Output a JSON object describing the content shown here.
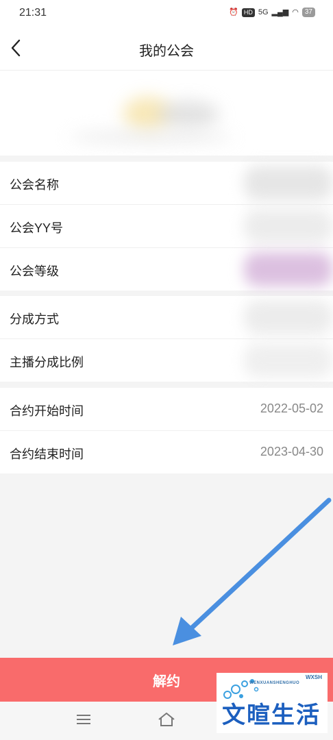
{
  "status_bar": {
    "time": "21:31",
    "hd_label": "HD",
    "network_label": "5G",
    "battery": "37"
  },
  "header": {
    "title": "我的公会",
    "back_icon": "chevron-left-icon"
  },
  "guild_info": {
    "rows": [
      {
        "label": "公会名称"
      },
      {
        "label": "公会YY号"
      },
      {
        "label": "公会等级"
      }
    ]
  },
  "revenue_info": {
    "rows": [
      {
        "label": "分成方式"
      },
      {
        "label": "主播分成比例"
      }
    ]
  },
  "contract_info": {
    "rows": [
      {
        "label": "合约开始时间",
        "value": "2022-05-02"
      },
      {
        "label": "合约结束时间",
        "value": "2023-04-30"
      }
    ]
  },
  "actions": {
    "terminate_label": "解约"
  },
  "nav_bar": {
    "icons": [
      "menu-icon",
      "home-icon",
      "back-icon"
    ]
  },
  "watermark": {
    "text": "文暄生活",
    "tag": "WXSH",
    "romanized": "WENXUANSHENGHUO"
  },
  "colors": {
    "accent": "#f96b6b",
    "arrow": "#4a8fe0",
    "background": "#f4f4f4"
  }
}
